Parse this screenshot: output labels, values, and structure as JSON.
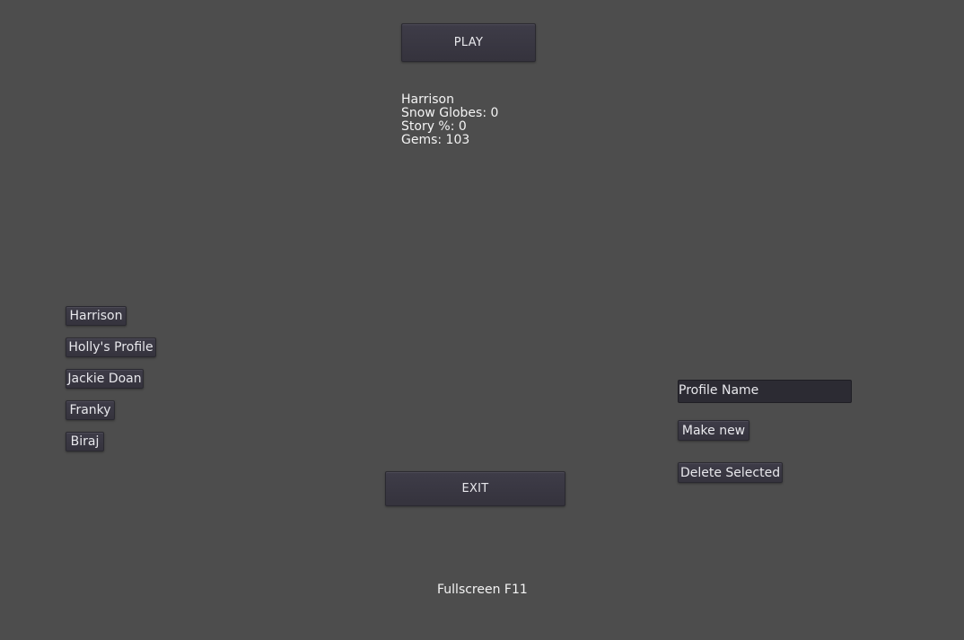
{
  "main_menu": {
    "play_label": "PLAY",
    "exit_label": "EXIT"
  },
  "selected_profile": {
    "name": "Harrison",
    "snow_globes": "Snow Globes: 0",
    "story_percent": "Story %: 0",
    "gems": "Gems: 103"
  },
  "profiles": [
    {
      "label": "Harrison"
    },
    {
      "label": "Holly's Profile"
    },
    {
      "label": "Jackie Doan"
    },
    {
      "label": "Franky"
    },
    {
      "label": "Biraj"
    }
  ],
  "profile_editor": {
    "name_input_value": "Profile Name",
    "make_new_label": "Make new",
    "delete_selected_label": "Delete Selected"
  },
  "footer": {
    "fullscreen_hint": "Fullscreen F11"
  },
  "colors": {
    "background": "#4d4d4d",
    "button": "#3a3843",
    "text": "#f0f0f0"
  }
}
